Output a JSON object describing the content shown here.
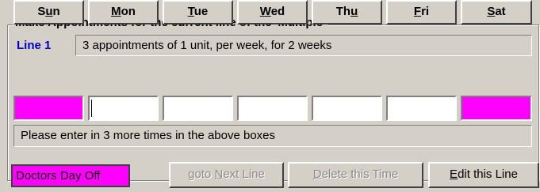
{
  "group": {
    "title": "Make Appointments for the current line of the 'Multiple'"
  },
  "line": {
    "label": "Line 1",
    "description": "3 appointments of 1 unit, per week, for 2 weeks"
  },
  "days": [
    {
      "pre": "S",
      "key": "u",
      "post": "n"
    },
    {
      "pre": "",
      "key": "M",
      "post": "on"
    },
    {
      "pre": "",
      "key": "T",
      "post": "ue"
    },
    {
      "pre": "",
      "key": "W",
      "post": "ed"
    },
    {
      "pre": "Th",
      "key": "u",
      "post": ""
    },
    {
      "pre": "",
      "key": "F",
      "post": "ri"
    },
    {
      "pre": "",
      "key": "S",
      "post": "at"
    }
  ],
  "status": "Please enter in 3 more times in the above boxes",
  "legend": {
    "label": "Doctors Day Off",
    "color": "#ff00ff"
  },
  "buttons": {
    "next": {
      "pre": "goto ",
      "key": "N",
      "post": "ext Line"
    },
    "delete": {
      "pre": "",
      "key": "D",
      "post": "elete this Time"
    },
    "edit": {
      "pre": "",
      "key": "E",
      "post": "dit this Line"
    }
  }
}
